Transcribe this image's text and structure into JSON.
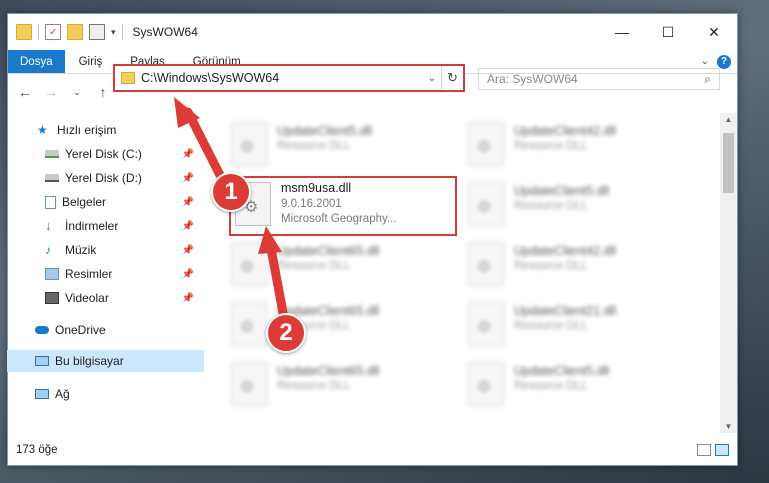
{
  "window": {
    "title": "SysWOW64"
  },
  "ribbon": {
    "tabs": [
      "Dosya",
      "Giriş",
      "Paylaş",
      "Görünüm"
    ]
  },
  "address": {
    "path": "C:\\Windows\\SysWOW64"
  },
  "search": {
    "placeholder": "Ara: SysWOW64"
  },
  "sidebar": {
    "items": [
      {
        "label": "Hızlı erişim",
        "icon": "star-icon"
      },
      {
        "label": "Yerel Disk (C:)",
        "icon": "drive-icon"
      },
      {
        "label": "Yerel Disk (D:)",
        "icon": "drive-icon"
      },
      {
        "label": "Belgeler",
        "icon": "documents-icon"
      },
      {
        "label": "İndirmeler",
        "icon": "download-icon"
      },
      {
        "label": "Müzik",
        "icon": "music-icon"
      },
      {
        "label": "Resimler",
        "icon": "pictures-icon"
      },
      {
        "label": "Videolar",
        "icon": "video-icon"
      },
      {
        "label": "OneDrive",
        "icon": "cloud-icon"
      },
      {
        "label": "Bu bilgisayar",
        "icon": "computer-icon"
      },
      {
        "label": "Ağ",
        "icon": "network-icon"
      }
    ]
  },
  "files": {
    "left": [
      {
        "name": "UpdateClient5.dll",
        "sub": "Resource DLL"
      },
      {
        "name": "UpdateClient65.dll",
        "sub": "Resource DLL"
      },
      {
        "name": "UpdateClient65.dll",
        "sub": "Resource DLL"
      },
      {
        "name": "UpdateClient65.dll",
        "sub": "Resource DLL"
      }
    ],
    "right": [
      {
        "name": "UpdateClient42.dll",
        "sub": "Resource DLL"
      },
      {
        "name": "UpdateClient5.dll",
        "sub": "Resource DLL"
      },
      {
        "name": "UpdateClient42.dll",
        "sub": "Resource DLL"
      },
      {
        "name": "UpdateClient21.dll",
        "sub": "Resource DLL"
      },
      {
        "name": "UpdateClient5.dll",
        "sub": "Resource DLL"
      }
    ],
    "highlighted": {
      "name": "msm9usa.dll",
      "version": "9.0.16.2001",
      "description": "Microsoft Geography..."
    }
  },
  "status": {
    "count": "173 öğe"
  },
  "annotations": {
    "badge1": "1",
    "badge2": "2",
    "accent": "#dd3b35"
  }
}
